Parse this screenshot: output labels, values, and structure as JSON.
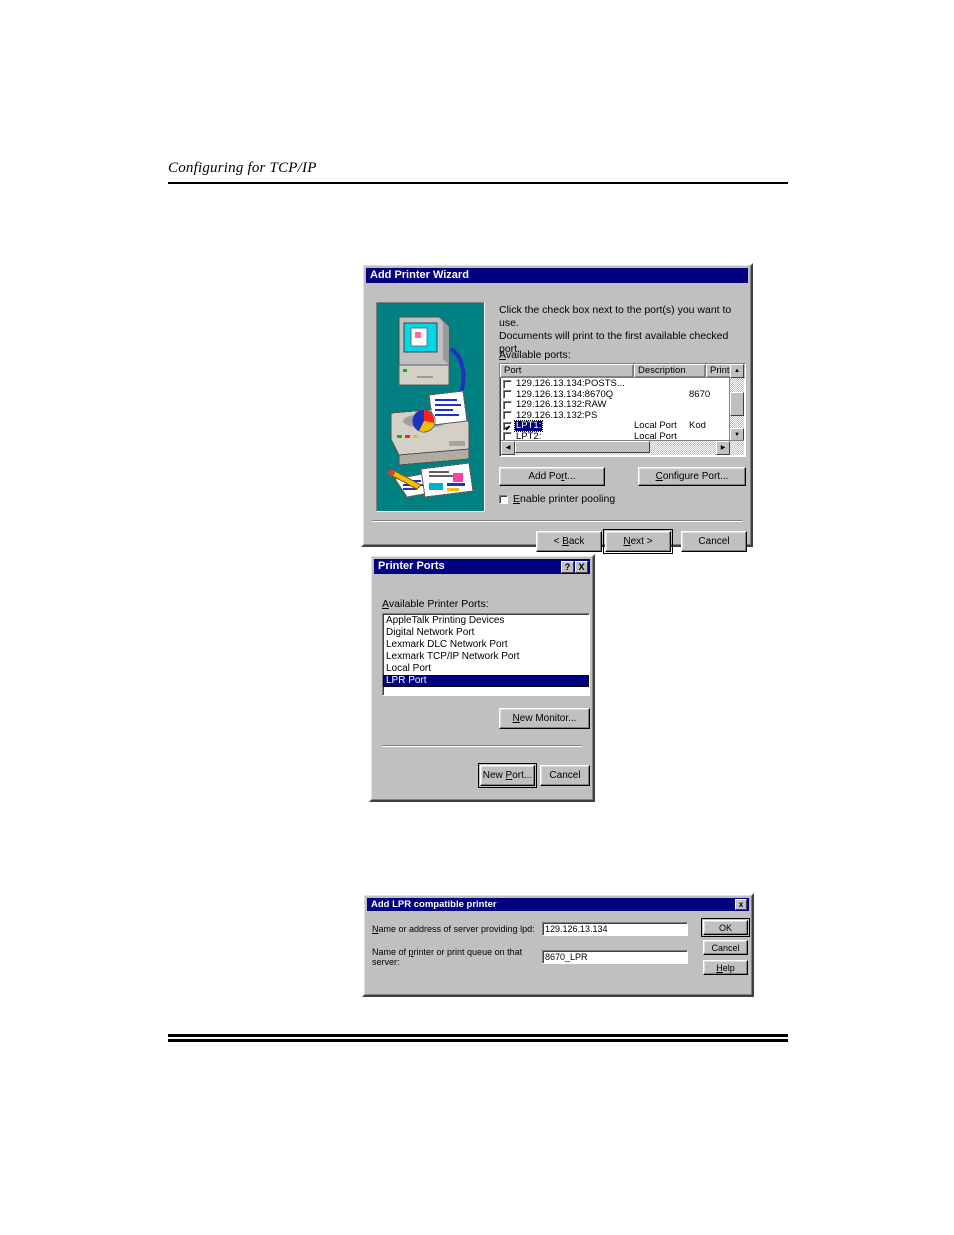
{
  "page": {
    "header_title": "Configuring for TCP/IP"
  },
  "wizard": {
    "title": "Add Printer Wizard",
    "instruction_line1": "Click the check box next to the port(s) you want to use.",
    "instruction_line2": "Documents will print to the first available checked port.",
    "ports_label": "Available ports:",
    "columns": [
      "Port",
      "Description",
      "Print"
    ],
    "ports": [
      {
        "name": "129.126.13.134:POSTS...",
        "description": "",
        "printer": "",
        "checked": false,
        "selected": false
      },
      {
        "name": "129.126.13.134:8670Q",
        "description": "",
        "printer": "8670",
        "checked": false,
        "selected": false
      },
      {
        "name": "129.126.13.132:RAW",
        "description": "",
        "printer": "",
        "checked": false,
        "selected": false
      },
      {
        "name": "129.126.13.132:PS",
        "description": "",
        "printer": "",
        "checked": false,
        "selected": false
      },
      {
        "name": "LPT1:",
        "description": "Local Port",
        "printer": "Kod",
        "checked": true,
        "selected": true
      },
      {
        "name": "LPT2:",
        "description": "Local Port",
        "printer": "",
        "checked": false,
        "selected": false
      }
    ],
    "add_port_label": "Add Port...",
    "configure_port_label": "Configure Port...",
    "pooling_label": "Enable printer pooling",
    "pooling_checked": false,
    "back_label": "< Back",
    "next_label": "Next >",
    "cancel_label": "Cancel",
    "art_background": "#008080"
  },
  "printer_ports": {
    "title": "Printer Ports",
    "help_button": "?",
    "close_button": "X",
    "list_label": "Available Printer Ports:",
    "items": [
      {
        "label": "AppleTalk Printing Devices",
        "selected": false
      },
      {
        "label": "Digital Network Port",
        "selected": false
      },
      {
        "label": "Lexmark DLC Network Port",
        "selected": false
      },
      {
        "label": "Lexmark TCP/IP Network Port",
        "selected": false
      },
      {
        "label": "Local Port",
        "selected": false
      },
      {
        "label": "LPR Port",
        "selected": true
      }
    ],
    "new_monitor_label": "New Monitor...",
    "new_port_label": "New Port...",
    "cancel_label": "Cancel"
  },
  "lpr_dialog": {
    "title": "Add LPR compatible printer",
    "close_button": "x",
    "server_label": "Name or address of server providing lpd:",
    "server_value": "129.126.13.134",
    "queue_label": "Name of printer or print queue on that server:",
    "queue_value": "8670_LPR",
    "ok_label": "OK",
    "cancel_label": "Cancel",
    "help_label": "Help"
  },
  "colors": {
    "titlebar": "#000080",
    "face": "#c0c0c0",
    "selection": "#000080",
    "artwork": "#008080"
  }
}
